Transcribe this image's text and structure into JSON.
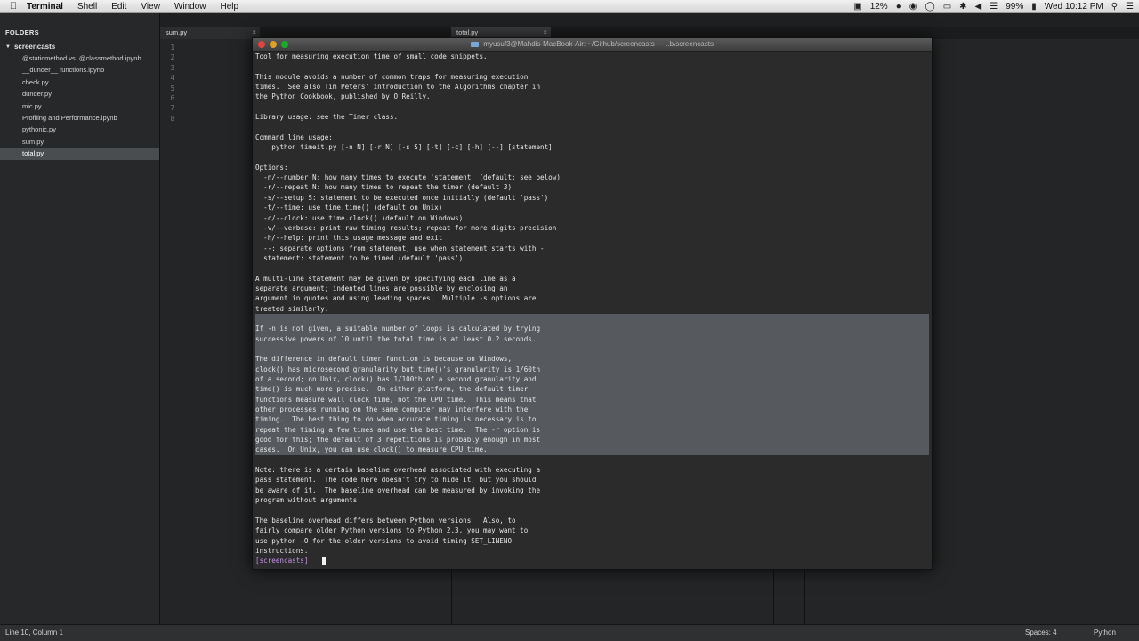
{
  "menubar": {
    "app": "Terminal",
    "menus": [
      "Shell",
      "Edit",
      "View",
      "Window",
      "Help"
    ],
    "cpu": "12%",
    "battery": "99%",
    "clock": "Wed 10:12 PM"
  },
  "sidebar": {
    "header": "FOLDERS",
    "folder": "screencasts",
    "items": [
      "@staticmethod vs. @classmethod.ipynb",
      "__dunder__ functions.ipynb",
      "check.py",
      "dunder.py",
      "mic.py",
      "Profiling and Performance.ipynb",
      "pythonic.py",
      "sum.py",
      "total.py"
    ],
    "selected_index": 8
  },
  "tabs": [
    "sum.py",
    "total.py"
  ],
  "editor": {
    "line_numbers": [
      "1",
      "2",
      "3",
      "4",
      "5",
      "6",
      "7",
      "8"
    ]
  },
  "terminal": {
    "title": "myusuf3@Mahdis-MacBook-Air: ~/Github/screencasts — ..b/screencasts",
    "lines": [
      "Tool for measuring execution time of small code snippets.",
      "",
      "This module avoids a number of common traps for measuring execution",
      "times.  See also Tim Peters' introduction to the Algorithms chapter in",
      "the Python Cookbook, published by O'Reilly.",
      "",
      "Library usage: see the Timer class.",
      "",
      "Command line usage:",
      "    python timeit.py [-n N] [-r N] [-s S] [-t] [-c] [-h] [--] [statement]",
      "",
      "Options:",
      "  -n/--number N: how many times to execute 'statement' (default: see below)",
      "  -r/--repeat N: how many times to repeat the timer (default 3)",
      "  -s/--setup S: statement to be executed once initially (default 'pass')",
      "  -t/--time: use time.time() (default on Unix)",
      "  -c/--clock: use time.clock() (default on Windows)",
      "  -v/--verbose: print raw timing results; repeat for more digits precision",
      "  -h/--help: print this usage message and exit",
      "  --: separate options from statement, use when statement starts with -",
      "  statement: statement to be timed (default 'pass')",
      "",
      "A multi-line statement may be given by specifying each line as a",
      "separate argument; indented lines are possible by enclosing an",
      "argument in quotes and using leading spaces.  Multiple -s options are",
      "treated similarly.",
      "",
      "If -n is not given, a suitable number of loops is calculated by trying",
      "successive powers of 10 until the total time is at least 0.2 seconds.",
      "",
      "The difference in default timer function is because on Windows,",
      "clock() has microsecond granularity but time()'s granularity is 1/60th",
      "of a second; on Unix, clock() has 1/100th of a second granularity and",
      "time() is much more precise.  On either platform, the default timer",
      "functions measure wall clock time, not the CPU time.  This means that",
      "other processes running on the same computer may interfere with the",
      "timing.  The best thing to do when accurate timing is necessary is to",
      "repeat the timing a few times and use the best time.  The -r option is",
      "good for this; the default of 3 repetitions is probably enough in most",
      "cases.  On Unix, you can use clock() to measure CPU time.",
      "",
      "Note: there is a certain baseline overhead associated with executing a",
      "pass statement.  The code here doesn't try to hide it, but you should",
      "be aware of it.  The baseline overhead can be measured by invoking the",
      "program without arguments.",
      "",
      "The baseline overhead differs between Python versions!  Also, to",
      "fairly compare older Python versions to Python 2.3, you may want to",
      "use python -O for the older versions to avoid timing SET_LINENO",
      "instructions."
    ],
    "selected_range": [
      26,
      39
    ],
    "prompt": "[screencasts]"
  },
  "statusbar": {
    "position": "Line 10, Column 1",
    "spaces": "Spaces: 4",
    "syntax": "Python"
  }
}
